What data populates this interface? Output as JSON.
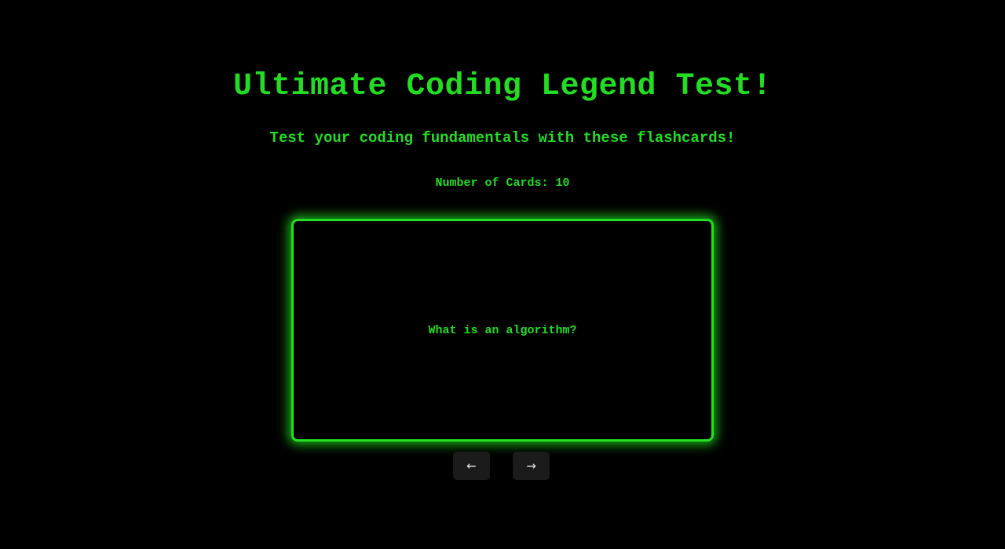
{
  "header": {
    "title": "Ultimate Coding Legend Test!",
    "subtitle": "Test your coding fundamentals with these flashcards!",
    "card_count": "Number of Cards: 10"
  },
  "flashcard": {
    "question": "What is an algorithm?"
  },
  "navigation": {
    "prev_label": "←",
    "next_label": "→",
    "prev_icon": "arrow-left-icon",
    "next_icon": "arrow-right-icon"
  },
  "colors": {
    "background": "#000000",
    "accent": "#22dd22",
    "button_bg": "#1b1b1b",
    "button_text": "#e6e6e6"
  }
}
